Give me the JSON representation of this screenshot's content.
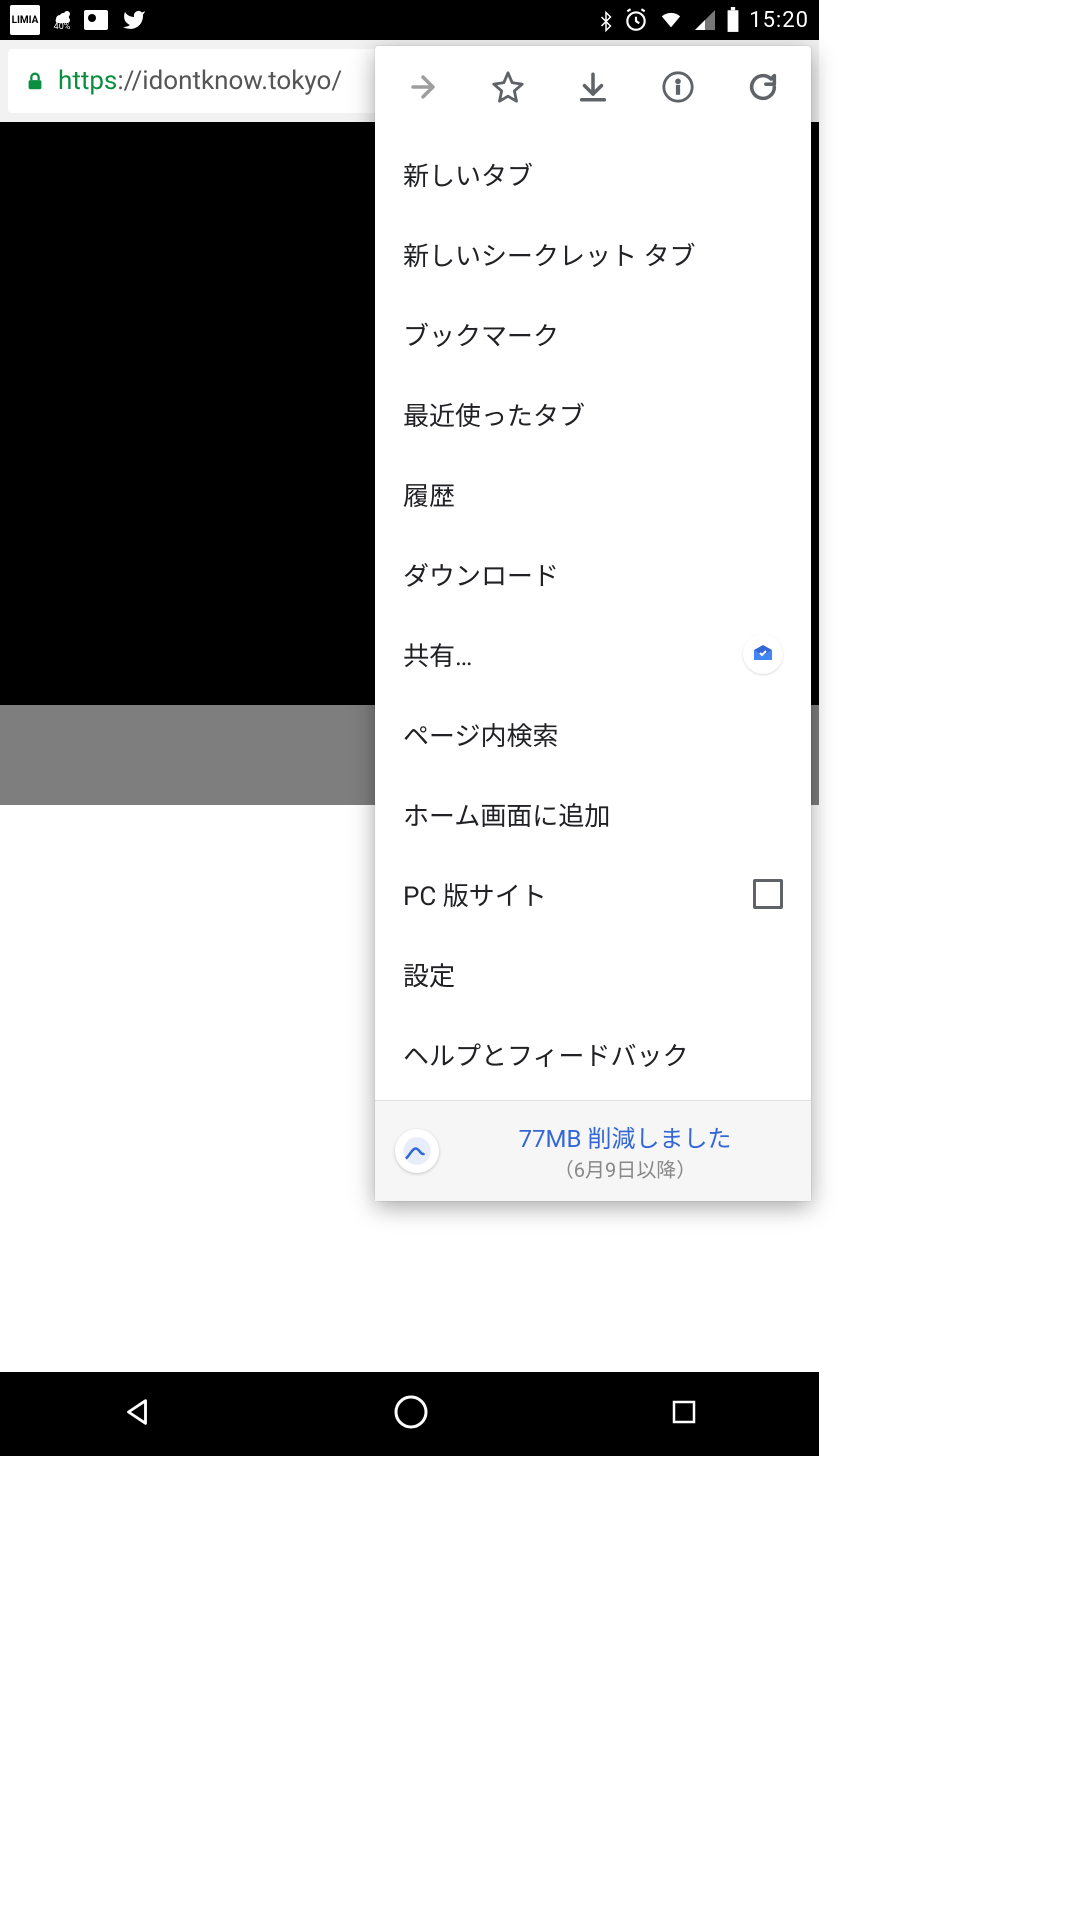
{
  "status_bar": {
    "limia_label": "LIMIA",
    "weather_percent": "40%",
    "time": "15:20"
  },
  "url_bar": {
    "scheme": "https",
    "rest": "://idontknow.tokyo/"
  },
  "menu": {
    "items": [
      {
        "label": "新しいタブ",
        "right": null
      },
      {
        "label": "新しいシークレット タブ",
        "right": null
      },
      {
        "label": "ブックマーク",
        "right": null
      },
      {
        "label": "最近使ったタブ",
        "right": null
      },
      {
        "label": "履歴",
        "right": null
      },
      {
        "label": "ダウンロード",
        "right": null
      },
      {
        "label": "共有…",
        "right": "inbox"
      },
      {
        "label": "ページ内検索",
        "right": null
      },
      {
        "label": "ホーム画面に追加",
        "right": null
      },
      {
        "label": "PC 版サイト",
        "right": "checkbox"
      },
      {
        "label": "設定",
        "right": null
      },
      {
        "label": "ヘルプとフィードバック",
        "right": null
      }
    ],
    "footer": {
      "title": "77MB 削減しました",
      "sub": "（6月9日以降）"
    }
  }
}
